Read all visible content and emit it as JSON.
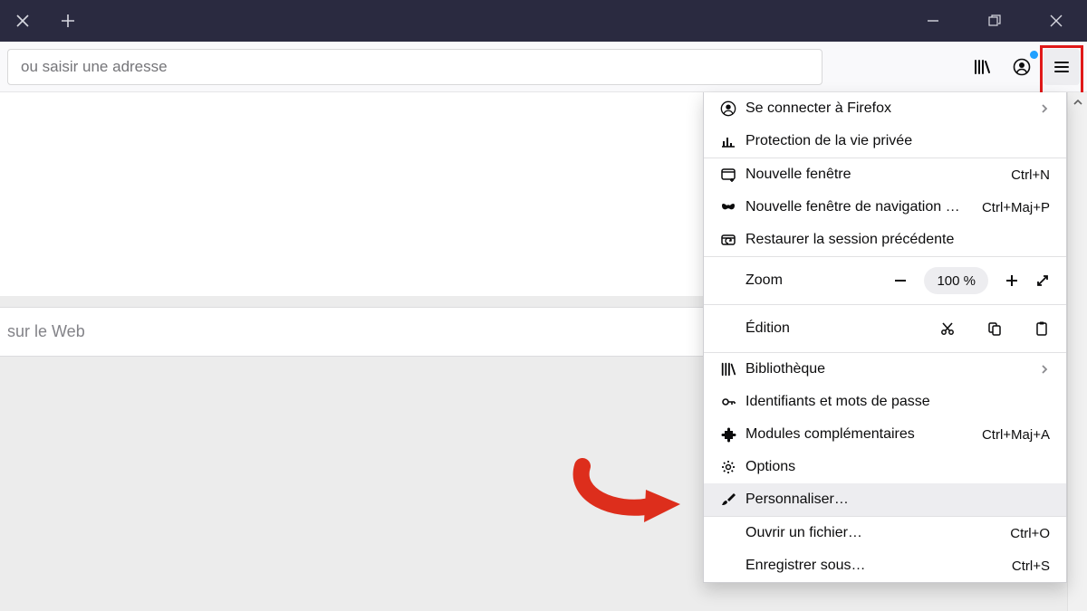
{
  "address": {
    "placeholder": "ou saisir une adresse"
  },
  "search": {
    "placeholder": "sur le Web"
  },
  "menu": {
    "signin": "Se connecter à Firefox",
    "privacy": "Protection de la vie privée",
    "newwin": {
      "label": "Nouvelle fenêtre",
      "short": "Ctrl+N"
    },
    "pbwin": {
      "label": "Nouvelle fenêtre de navigation …",
      "short": "Ctrl+Maj+P"
    },
    "restore": "Restaurer la session précédente",
    "zoom": {
      "label": "Zoom",
      "value": "100 %"
    },
    "edit": {
      "label": "Édition"
    },
    "library": "Bibliothèque",
    "logins": "Identifiants et mots de passe",
    "addons": {
      "label": "Modules complémentaires",
      "short": "Ctrl+Maj+A"
    },
    "options": "Options",
    "customize": "Personnaliser…",
    "open": {
      "label": "Ouvrir un fichier…",
      "short": "Ctrl+O"
    },
    "saveas": {
      "label": "Enregistrer sous…",
      "short": "Ctrl+S"
    }
  }
}
